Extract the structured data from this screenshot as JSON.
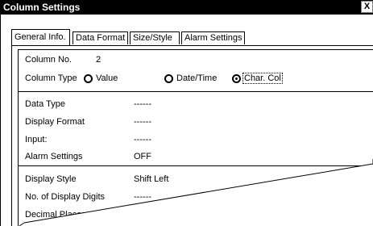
{
  "window": {
    "title": "Column Settings",
    "close_label": "X"
  },
  "tabs": [
    {
      "label": "General Info."
    },
    {
      "label": "Data Format"
    },
    {
      "label": "Size/Style"
    },
    {
      "label": "Alarm Settings"
    }
  ],
  "general": {
    "column_no_label": "Column No.",
    "column_no_value": "2",
    "column_type_label": "Column Type",
    "column_type_options": [
      "Value",
      "Date/Time",
      "Char. Col"
    ],
    "column_type_selected": "Char. Col"
  },
  "data_section": {
    "data_type_label": "Data Type",
    "data_type_value": "------",
    "display_format_label": "Display Format",
    "display_format_value": "------",
    "input_label": "Input:",
    "input_value": "------",
    "alarm_label": "Alarm Settings",
    "alarm_value": "OFF"
  },
  "style_section": {
    "display_style_label": "Display Style",
    "display_style_value": "Shift Left",
    "digits_label": "No. of Display Digits",
    "digits_value": "------",
    "decimal_label": "Decimal Places"
  }
}
